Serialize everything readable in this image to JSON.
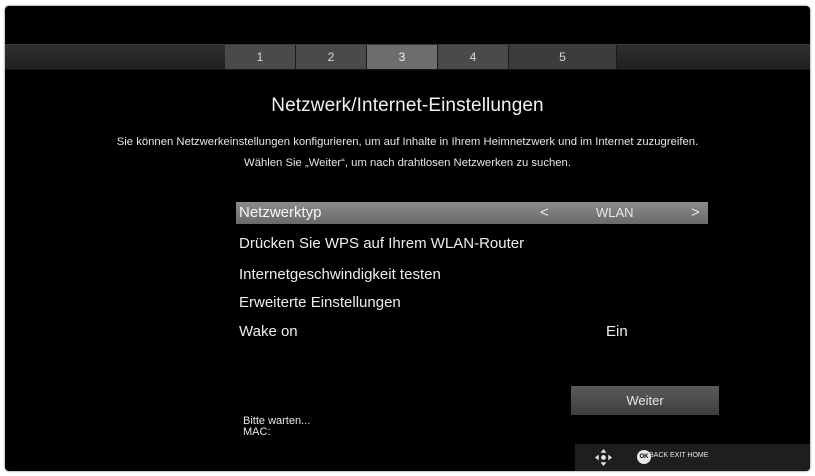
{
  "header": {
    "steps": [
      "1",
      "2",
      "3",
      "4",
      "5"
    ],
    "active_step": "3"
  },
  "page": {
    "title": "Netzwerk/Internet-Einstellungen",
    "description_line1": "Sie können Netzwerkeinstellungen konfigurieren, um auf Inhalte in Ihrem Heimnetzwerk und im Internet zuzugreifen.",
    "description_line2": "Wählen Sie „Weiter“, um nach drahtlosen Netzwerken zu suchen."
  },
  "menu": {
    "network_type": {
      "label": "Netzwerktyp",
      "value": "WLAN",
      "left_arrow": "<",
      "right_arrow": ">"
    },
    "wps": {
      "label": "Drücken Sie WPS auf Ihrem WLAN-Router"
    },
    "speed_test": {
      "label": "Internetgeschwindigkeit testen"
    },
    "advanced": {
      "label": "Erweiterte Einstellungen"
    },
    "wake_on": {
      "label": "Wake on",
      "value": "Ein"
    }
  },
  "actions": {
    "next_label": "Weiter"
  },
  "status": {
    "line1": "Bitte warten...",
    "line2": "MAC:"
  },
  "footer": {
    "ok_label": "OK",
    "nav_text": "BACK EXIT HOME",
    "icons": [
      "dpad-icon",
      "ok-button-icon"
    ]
  },
  "colors": {
    "background": "#000000",
    "selected_row": "#7a7a7a",
    "topbar": "#2a2a2a"
  }
}
